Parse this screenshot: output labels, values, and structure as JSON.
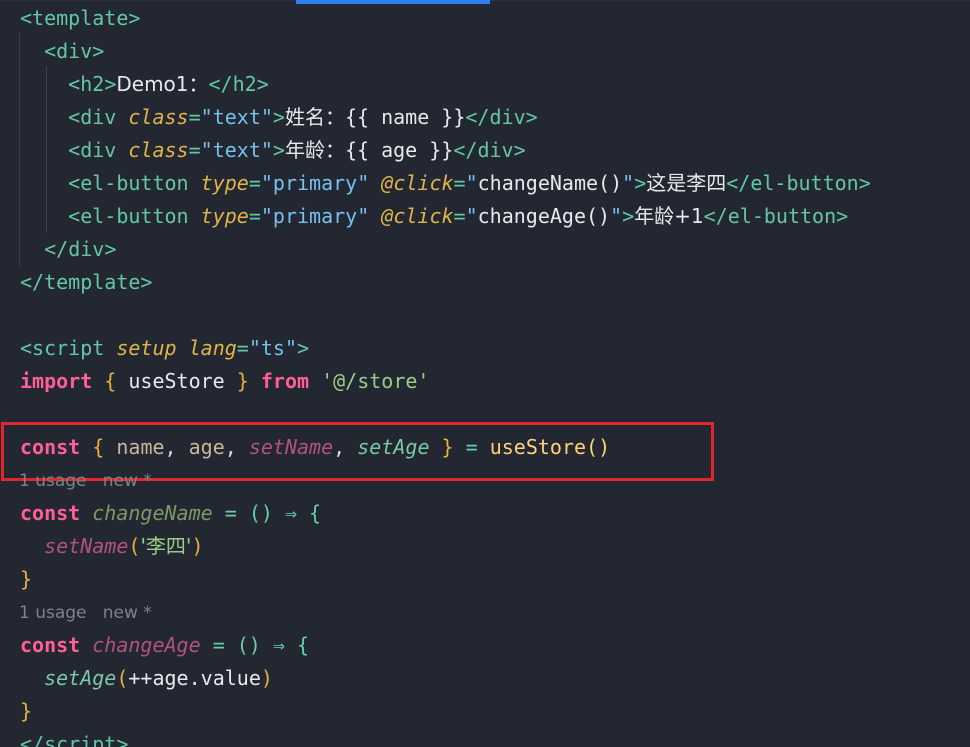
{
  "template": {
    "open_tag": "template",
    "close_tag": "template",
    "div_tag": "div",
    "h2_tag": "h2",
    "h2_text": "Demo1：",
    "div_class_attr": "class",
    "text_class": "text",
    "name_label": "姓名：",
    "name_expr": "{{ name }}",
    "age_label": "年龄：",
    "age_expr": "{{ age }}",
    "button_tag": "el-button",
    "type_attr": "type",
    "primary_value": "primary",
    "click_attr": "@click",
    "change_name_handler": "changeName()",
    "change_name_label": "这是李四",
    "change_age_handler": "changeAge()",
    "change_age_label": "年龄+1"
  },
  "script": {
    "open_tag": "script",
    "setup_attr": "setup",
    "lang_attr": "lang",
    "lang_value": "ts",
    "close_tag": "script",
    "import_kw": "import",
    "use_store_name": "useStore",
    "from_kw": "from",
    "store_path": "'@/store'",
    "const_kw": "const",
    "name_var": "name",
    "age_var": "age",
    "set_name_fn": "setName",
    "set_age_fn": "setAge",
    "use_store_call": "useStore()",
    "change_name_fn": "changeName",
    "change_age_fn": "changeAge",
    "arrow_open": "= () ⇒ {",
    "set_name_arg": "'李四'",
    "set_age_arg": "++age",
    "value_prop": ".value"
  },
  "hints": {
    "hint1": "1 usage   new *",
    "hint2": "1 usage   new *"
  },
  "colors": {
    "background": "#222731",
    "highlight_border": "#e0272b",
    "tab_indicator": "#2f7ff0"
  }
}
